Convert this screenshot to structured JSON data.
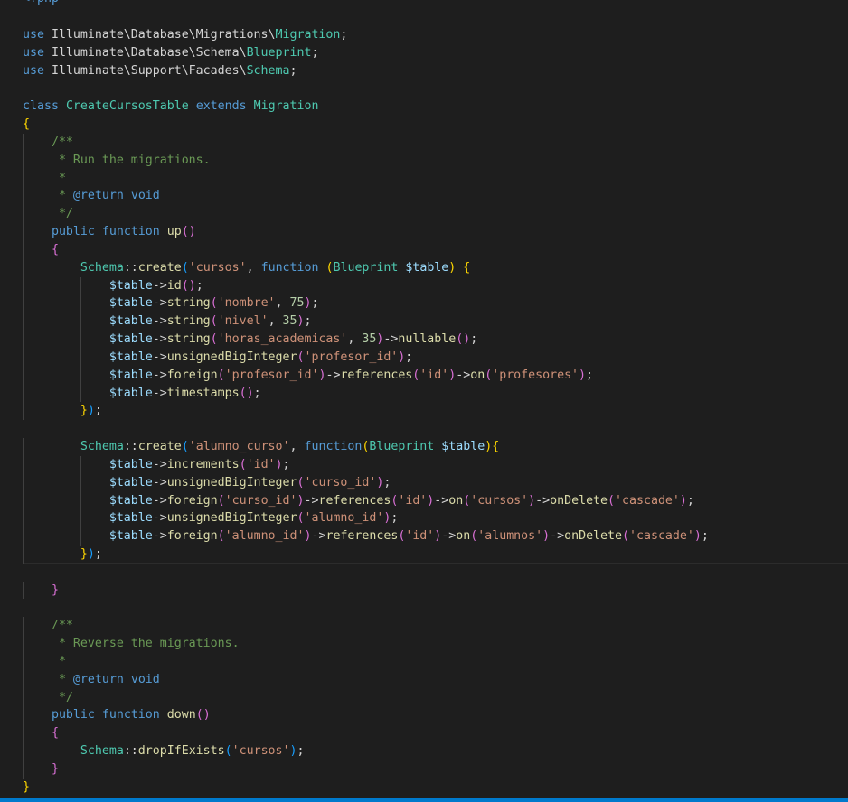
{
  "editor": {
    "language": "php",
    "accent": "#007acc",
    "background": "#1e1e1e"
  },
  "lines": [
    [
      [
        "<?php",
        "tag"
      ]
    ],
    [],
    [
      [
        "use",
        "kw"
      ],
      [
        " Illuminate\\Database\\Migrations\\",
        "p"
      ],
      [
        "Migration",
        "cls"
      ],
      [
        ";",
        "p"
      ]
    ],
    [
      [
        "use",
        "kw"
      ],
      [
        " Illuminate\\Database\\Schema\\",
        "p"
      ],
      [
        "Blueprint",
        "cls"
      ],
      [
        ";",
        "p"
      ]
    ],
    [
      [
        "use",
        "kw"
      ],
      [
        " Illuminate\\Support\\Facades\\",
        "p"
      ],
      [
        "Schema",
        "cls"
      ],
      [
        ";",
        "p"
      ]
    ],
    [],
    [
      [
        "class",
        "kw"
      ],
      [
        " ",
        "p"
      ],
      [
        "CreateCursosTable",
        "cls"
      ],
      [
        " ",
        "p"
      ],
      [
        "extends",
        "kw"
      ],
      [
        " ",
        "p"
      ],
      [
        "Migration",
        "cls"
      ]
    ],
    [
      [
        "{",
        "b1"
      ]
    ],
    [
      [
        "    ",
        "p"
      ],
      [
        "/**",
        "com"
      ]
    ],
    [
      [
        "    ",
        "p"
      ],
      [
        " * Run the migrations.",
        "com"
      ]
    ],
    [
      [
        "    ",
        "p"
      ],
      [
        " *",
        "com"
      ]
    ],
    [
      [
        "    ",
        "p"
      ],
      [
        " * ",
        "com"
      ],
      [
        "@return",
        "kw"
      ],
      [
        " ",
        "com"
      ],
      [
        "void",
        "kw"
      ]
    ],
    [
      [
        "    ",
        "p"
      ],
      [
        " */",
        "com"
      ]
    ],
    [
      [
        "    ",
        "p"
      ],
      [
        "public",
        "kw"
      ],
      [
        " ",
        "p"
      ],
      [
        "function",
        "kw"
      ],
      [
        " ",
        "p"
      ],
      [
        "up",
        "fn"
      ],
      [
        "()",
        "b2"
      ]
    ],
    [
      [
        "    ",
        "p"
      ],
      [
        "{",
        "b2"
      ]
    ],
    [
      [
        "        ",
        "p"
      ],
      [
        "Schema",
        "cls"
      ],
      [
        "::",
        "p"
      ],
      [
        "create",
        "fn"
      ],
      [
        "(",
        "b3"
      ],
      [
        "'cursos'",
        "str"
      ],
      [
        ", ",
        "p"
      ],
      [
        "function",
        "kw"
      ],
      [
        " ",
        "p"
      ],
      [
        "(",
        "b1"
      ],
      [
        "Blueprint",
        "cls"
      ],
      [
        " ",
        "p"
      ],
      [
        "$table",
        "var"
      ],
      [
        ")",
        "b1"
      ],
      [
        " ",
        "p"
      ],
      [
        "{",
        "b1"
      ]
    ],
    [
      [
        "            ",
        "p"
      ],
      [
        "$table",
        "var"
      ],
      [
        "->",
        "p"
      ],
      [
        "id",
        "fn"
      ],
      [
        "()",
        "b2"
      ],
      [
        ";",
        "p"
      ]
    ],
    [
      [
        "            ",
        "p"
      ],
      [
        "$table",
        "var"
      ],
      [
        "->",
        "p"
      ],
      [
        "string",
        "fn"
      ],
      [
        "(",
        "b2"
      ],
      [
        "'nombre'",
        "str"
      ],
      [
        ", ",
        "p"
      ],
      [
        "75",
        "num"
      ],
      [
        ")",
        "b2"
      ],
      [
        ";",
        "p"
      ]
    ],
    [
      [
        "            ",
        "p"
      ],
      [
        "$table",
        "var"
      ],
      [
        "->",
        "p"
      ],
      [
        "string",
        "fn"
      ],
      [
        "(",
        "b2"
      ],
      [
        "'nivel'",
        "str"
      ],
      [
        ", ",
        "p"
      ],
      [
        "35",
        "num"
      ],
      [
        ")",
        "b2"
      ],
      [
        ";",
        "p"
      ]
    ],
    [
      [
        "            ",
        "p"
      ],
      [
        "$table",
        "var"
      ],
      [
        "->",
        "p"
      ],
      [
        "string",
        "fn"
      ],
      [
        "(",
        "b2"
      ],
      [
        "'horas_academicas'",
        "str"
      ],
      [
        ", ",
        "p"
      ],
      [
        "35",
        "num"
      ],
      [
        ")",
        "b2"
      ],
      [
        "->",
        "p"
      ],
      [
        "nullable",
        "fn"
      ],
      [
        "()",
        "b2"
      ],
      [
        ";",
        "p"
      ]
    ],
    [
      [
        "            ",
        "p"
      ],
      [
        "$table",
        "var"
      ],
      [
        "->",
        "p"
      ],
      [
        "unsignedBigInteger",
        "fn"
      ],
      [
        "(",
        "b2"
      ],
      [
        "'profesor_id'",
        "str"
      ],
      [
        ")",
        "b2"
      ],
      [
        ";",
        "p"
      ]
    ],
    [
      [
        "            ",
        "p"
      ],
      [
        "$table",
        "var"
      ],
      [
        "->",
        "p"
      ],
      [
        "foreign",
        "fn"
      ],
      [
        "(",
        "b2"
      ],
      [
        "'profesor_id'",
        "str"
      ],
      [
        ")",
        "b2"
      ],
      [
        "->",
        "p"
      ],
      [
        "references",
        "fn"
      ],
      [
        "(",
        "b2"
      ],
      [
        "'id'",
        "str"
      ],
      [
        ")",
        "b2"
      ],
      [
        "->",
        "p"
      ],
      [
        "on",
        "fn"
      ],
      [
        "(",
        "b2"
      ],
      [
        "'profesores'",
        "str"
      ],
      [
        ")",
        "b2"
      ],
      [
        ";",
        "p"
      ]
    ],
    [
      [
        "            ",
        "p"
      ],
      [
        "$table",
        "var"
      ],
      [
        "->",
        "p"
      ],
      [
        "timestamps",
        "fn"
      ],
      [
        "()",
        "b2"
      ],
      [
        ";",
        "p"
      ]
    ],
    [
      [
        "        ",
        "p"
      ],
      [
        "}",
        "b1"
      ],
      [
        ")",
        "b3"
      ],
      [
        ";",
        "p"
      ]
    ],
    [],
    [
      [
        "        ",
        "p"
      ],
      [
        "Schema",
        "cls"
      ],
      [
        "::",
        "p"
      ],
      [
        "create",
        "fn"
      ],
      [
        "(",
        "b3"
      ],
      [
        "'alumno_curso'",
        "str"
      ],
      [
        ", ",
        "p"
      ],
      [
        "function",
        "kw"
      ],
      [
        "(",
        "b1"
      ],
      [
        "Blueprint",
        "cls"
      ],
      [
        " ",
        "p"
      ],
      [
        "$table",
        "var"
      ],
      [
        ")",
        "b1"
      ],
      [
        "{",
        "b1"
      ]
    ],
    [
      [
        "            ",
        "p"
      ],
      [
        "$table",
        "var"
      ],
      [
        "->",
        "p"
      ],
      [
        "increments",
        "fn"
      ],
      [
        "(",
        "b2"
      ],
      [
        "'id'",
        "str"
      ],
      [
        ")",
        "b2"
      ],
      [
        ";",
        "p"
      ]
    ],
    [
      [
        "            ",
        "p"
      ],
      [
        "$table",
        "var"
      ],
      [
        "->",
        "p"
      ],
      [
        "unsignedBigInteger",
        "fn"
      ],
      [
        "(",
        "b2"
      ],
      [
        "'curso_id'",
        "str"
      ],
      [
        ")",
        "b2"
      ],
      [
        ";",
        "p"
      ]
    ],
    [
      [
        "            ",
        "p"
      ],
      [
        "$table",
        "var"
      ],
      [
        "->",
        "p"
      ],
      [
        "foreign",
        "fn"
      ],
      [
        "(",
        "b2"
      ],
      [
        "'curso_id'",
        "str"
      ],
      [
        ")",
        "b2"
      ],
      [
        "->",
        "p"
      ],
      [
        "references",
        "fn"
      ],
      [
        "(",
        "b2"
      ],
      [
        "'id'",
        "str"
      ],
      [
        ")",
        "b2"
      ],
      [
        "->",
        "p"
      ],
      [
        "on",
        "fn"
      ],
      [
        "(",
        "b2"
      ],
      [
        "'cursos'",
        "str"
      ],
      [
        ")",
        "b2"
      ],
      [
        "->",
        "p"
      ],
      [
        "onDelete",
        "fn"
      ],
      [
        "(",
        "b2"
      ],
      [
        "'cascade'",
        "str"
      ],
      [
        ")",
        "b2"
      ],
      [
        ";",
        "p"
      ]
    ],
    [
      [
        "            ",
        "p"
      ],
      [
        "$table",
        "var"
      ],
      [
        "->",
        "p"
      ],
      [
        "unsignedBigInteger",
        "fn"
      ],
      [
        "(",
        "b2"
      ],
      [
        "'alumno_id'",
        "str"
      ],
      [
        ")",
        "b2"
      ],
      [
        ";",
        "p"
      ]
    ],
    [
      [
        "            ",
        "p"
      ],
      [
        "$table",
        "var"
      ],
      [
        "->",
        "p"
      ],
      [
        "foreign",
        "fn"
      ],
      [
        "(",
        "b2"
      ],
      [
        "'alumno_id'",
        "str"
      ],
      [
        ")",
        "b2"
      ],
      [
        "->",
        "p"
      ],
      [
        "references",
        "fn"
      ],
      [
        "(",
        "b2"
      ],
      [
        "'id'",
        "str"
      ],
      [
        ")",
        "b2"
      ],
      [
        "->",
        "p"
      ],
      [
        "on",
        "fn"
      ],
      [
        "(",
        "b2"
      ],
      [
        "'alumnos'",
        "str"
      ],
      [
        ")",
        "b2"
      ],
      [
        "->",
        "p"
      ],
      [
        "onDelete",
        "fn"
      ],
      [
        "(",
        "b2"
      ],
      [
        "'cascade'",
        "str"
      ],
      [
        ")",
        "b2"
      ],
      [
        ";",
        "p"
      ]
    ],
    [
      [
        "        ",
        "p"
      ],
      [
        "}",
        "b1"
      ],
      [
        ")",
        "b3"
      ],
      [
        ";",
        "p"
      ]
    ],
    [],
    [
      [
        "    ",
        "p"
      ],
      [
        "}",
        "b2"
      ]
    ],
    [],
    [
      [
        "    ",
        "p"
      ],
      [
        "/**",
        "com"
      ]
    ],
    [
      [
        "    ",
        "p"
      ],
      [
        " * Reverse the migrations.",
        "com"
      ]
    ],
    [
      [
        "    ",
        "p"
      ],
      [
        " *",
        "com"
      ]
    ],
    [
      [
        "    ",
        "p"
      ],
      [
        " * ",
        "com"
      ],
      [
        "@return",
        "kw"
      ],
      [
        " ",
        "com"
      ],
      [
        "void",
        "kw"
      ]
    ],
    [
      [
        "    ",
        "p"
      ],
      [
        " */",
        "com"
      ]
    ],
    [
      [
        "    ",
        "p"
      ],
      [
        "public",
        "kw"
      ],
      [
        " ",
        "p"
      ],
      [
        "function",
        "kw"
      ],
      [
        " ",
        "p"
      ],
      [
        "down",
        "fn"
      ],
      [
        "()",
        "b2"
      ]
    ],
    [
      [
        "    ",
        "p"
      ],
      [
        "{",
        "b2"
      ]
    ],
    [
      [
        "        ",
        "p"
      ],
      [
        "Schema",
        "cls"
      ],
      [
        "::",
        "p"
      ],
      [
        "dropIfExists",
        "fn"
      ],
      [
        "(",
        "b3"
      ],
      [
        "'cursos'",
        "str"
      ],
      [
        ")",
        "b3"
      ],
      [
        ";",
        "p"
      ]
    ],
    [
      [
        "    ",
        "p"
      ],
      [
        "}",
        "b2"
      ]
    ],
    [
      [
        "}",
        "b1"
      ]
    ]
  ]
}
